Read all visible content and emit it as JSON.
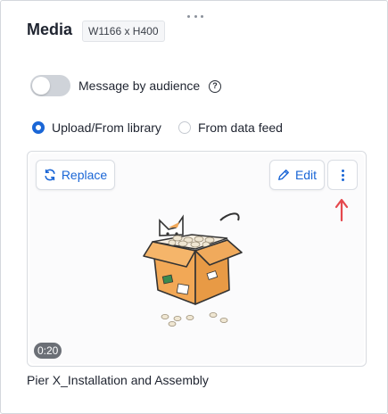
{
  "panel": {
    "title": "Media",
    "dimensions_badge": "W1166 x H400"
  },
  "audience_toggle": {
    "label": "Message by audience",
    "enabled": false,
    "help_icon": "help-circle-icon"
  },
  "source_options": [
    {
      "label": "Upload/From library",
      "selected": true
    },
    {
      "label": "From data feed",
      "selected": false
    }
  ],
  "media": {
    "replace_label": "Replace",
    "edit_label": "Edit",
    "duration": "0:20",
    "file_name": "Pier X_Installation and Assembly"
  },
  "colors": {
    "accent": "#1a66d6",
    "annotation_arrow": "#e5484d"
  }
}
